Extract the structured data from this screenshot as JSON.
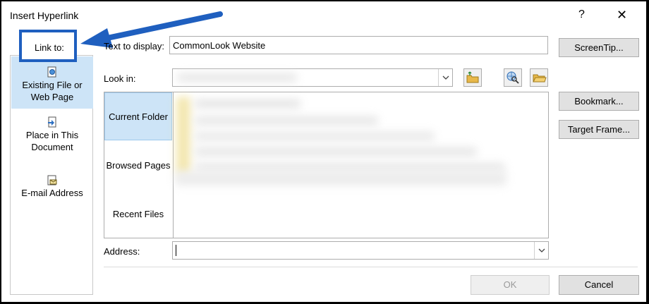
{
  "window": {
    "title": "Insert Hyperlink",
    "help_glyph": "?",
    "close_glyph": "✕"
  },
  "link_to": {
    "label": "Link to:"
  },
  "nav": {
    "items": [
      {
        "line1": "Existing File or",
        "line2": "Web Page"
      },
      {
        "line1": "Place in This",
        "line2": "Document"
      },
      {
        "line1": "E-mail Address",
        "line2": ""
      }
    ]
  },
  "text_to_display": {
    "label": "Text to display:",
    "value": "CommonLook Website"
  },
  "look_in": {
    "label": "Look in:"
  },
  "browse_tabs": [
    "Current Folder",
    "Browsed Pages",
    "Recent Files"
  ],
  "address": {
    "label": "Address:",
    "value": ""
  },
  "buttons": {
    "screentip": "ScreenTip...",
    "bookmark": "Bookmark...",
    "target_frame": "Target Frame...",
    "ok": "OK",
    "cancel": "Cancel"
  },
  "colors": {
    "highlight_box": "#1f5fbf",
    "selected_bg": "#cde4f7"
  }
}
